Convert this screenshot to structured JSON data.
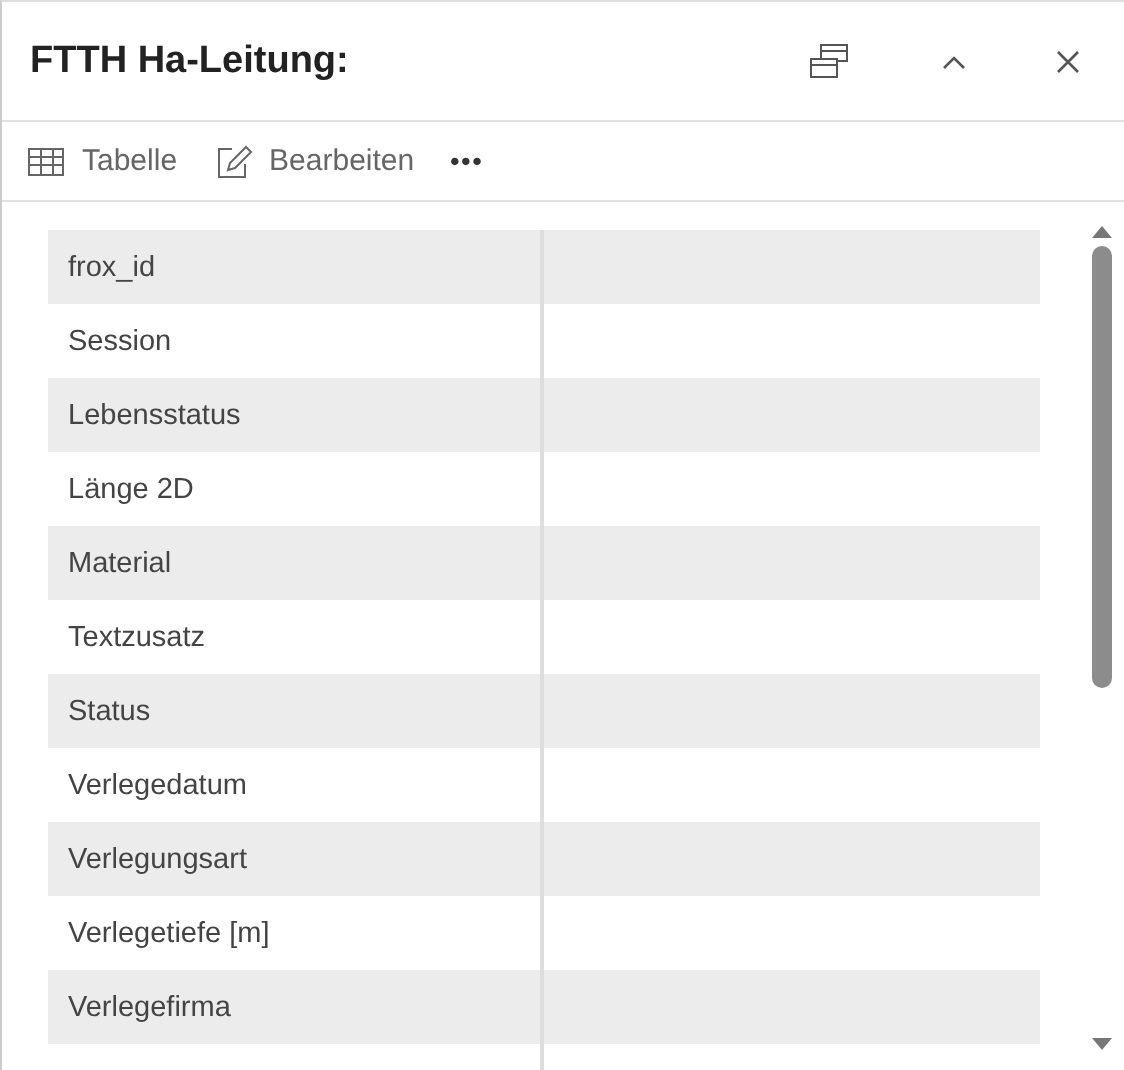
{
  "window": {
    "title": "FTTH Ha-Leitung:"
  },
  "toolbar": [
    {
      "kind": "table",
      "label": "Tabelle"
    },
    {
      "kind": "edit",
      "label": "Bearbeiten"
    },
    {
      "kind": "more",
      "label": "•••"
    }
  ],
  "fields": [
    {
      "name": "frox_id"
    },
    {
      "name": "Session"
    },
    {
      "name": "Lebensstatus"
    },
    {
      "name": "Länge 2D"
    },
    {
      "name": "Material"
    },
    {
      "name": "Textzusatz"
    },
    {
      "name": "Status"
    },
    {
      "name": "Verlegedatum"
    },
    {
      "name": "Verlegungsart"
    },
    {
      "name": "Verlegetiefe [m]"
    },
    {
      "name": "Verlegefirma"
    }
  ]
}
